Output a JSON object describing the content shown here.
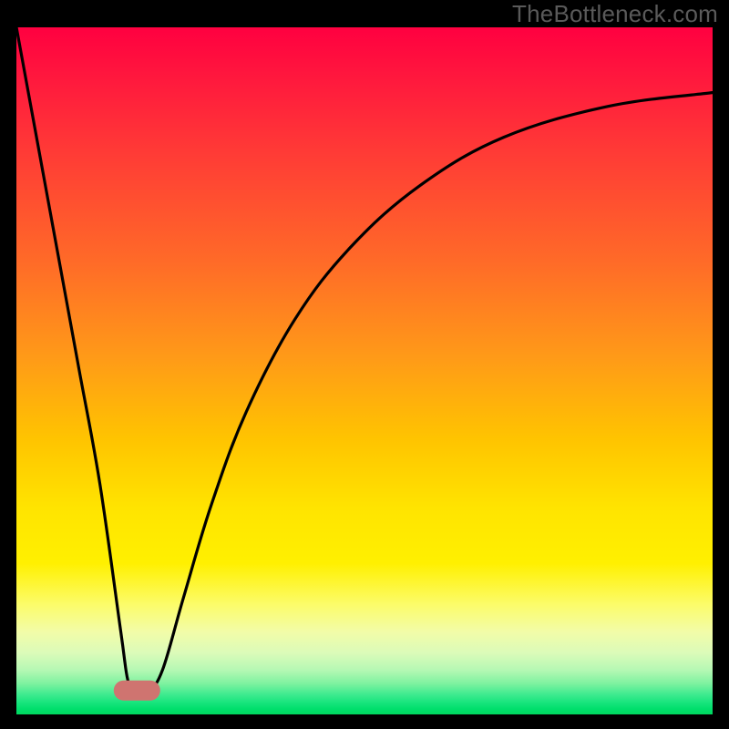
{
  "watermark": "TheBottleneck.com",
  "chart_data": {
    "type": "line",
    "title": "",
    "xlabel": "",
    "ylabel": "",
    "xlim": [
      0,
      100
    ],
    "ylim": [
      0,
      100
    ],
    "grid": false,
    "legend": false,
    "background_gradient": {
      "direction": "vertical",
      "stops": [
        {
          "pos": 0.0,
          "color": "#ff0040"
        },
        {
          "pos": 0.34,
          "color": "#ff6a28"
        },
        {
          "pos": 0.6,
          "color": "#ffc400"
        },
        {
          "pos": 0.78,
          "color": "#fff000"
        },
        {
          "pos": 0.93,
          "color": "#b6f8b4"
        },
        {
          "pos": 1.0,
          "color": "#00d85e"
        }
      ]
    },
    "series": [
      {
        "name": "bottleneck-curve",
        "color": "#000000",
        "x": [
          0.0,
          3.0,
          6.0,
          9.0,
          12.0,
          15.0,
          16.0,
          17.0,
          19.0,
          21.0,
          24.0,
          28.0,
          33.0,
          40.0,
          48.0,
          58.0,
          70.0,
          85.0,
          100.0
        ],
        "y": [
          100.0,
          83.4,
          66.8,
          50.2,
          33.5,
          12.0,
          5.0,
          3.5,
          3.5,
          6.5,
          17.0,
          30.5,
          44.0,
          57.5,
          68.0,
          77.0,
          84.0,
          88.5,
          90.5
        ]
      }
    ],
    "marker": {
      "name": "optimal-range",
      "shape": "pill",
      "color": "#cf7470",
      "x": 17.3,
      "y": 3.5,
      "width_frac": 0.066,
      "height_frac": 0.03
    }
  },
  "colors": {
    "frame": "#000000",
    "curve": "#000000",
    "marker": "#cf7470",
    "watermark_text": "#5a5a5a"
  }
}
